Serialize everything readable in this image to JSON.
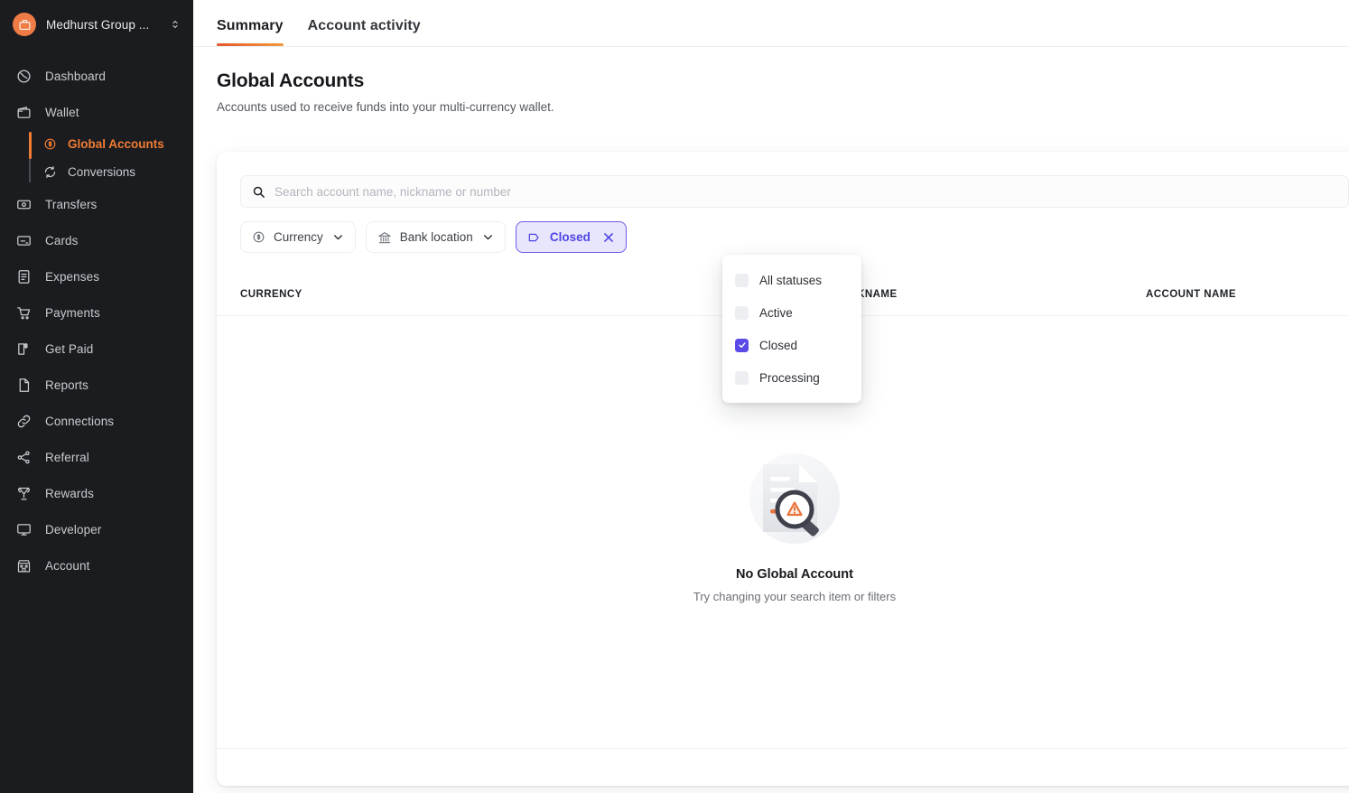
{
  "sidebar": {
    "org": {
      "name": "Medhurst Group ...",
      "logo_icon": "briefcase-icon",
      "switcher_icon": "chevron-up-down-icon",
      "logo_color": "#ef7b45"
    },
    "items": [
      {
        "label": "Dashboard",
        "icon": "dashboard-icon"
      },
      {
        "label": "Wallet",
        "icon": "wallet-icon"
      },
      {
        "label": "Transfers",
        "icon": "transfers-icon"
      },
      {
        "label": "Cards",
        "icon": "cards-icon"
      },
      {
        "label": "Expenses",
        "icon": "expenses-icon"
      },
      {
        "label": "Payments",
        "icon": "payments-cart-icon"
      },
      {
        "label": "Get Paid",
        "icon": "get-paid-icon"
      },
      {
        "label": "Reports",
        "icon": "reports-document-icon"
      },
      {
        "label": "Connections",
        "icon": "connections-link-icon"
      },
      {
        "label": "Referral",
        "icon": "referral-share-icon"
      },
      {
        "label": "Rewards",
        "icon": "rewards-trophy-icon"
      },
      {
        "label": "Developer",
        "icon": "developer-monitor-icon"
      },
      {
        "label": "Account",
        "icon": "account-building-icon"
      }
    ],
    "subitems": [
      {
        "label": "Global Accounts",
        "icon": "coin-dollar-icon",
        "active": true
      },
      {
        "label": "Conversions",
        "icon": "conversions-refresh-icon",
        "active": false
      }
    ],
    "active_color": "#f07c33"
  },
  "tabs": [
    {
      "label": "Summary",
      "active": true
    },
    {
      "label": "Account activity",
      "active": false
    }
  ],
  "page": {
    "title": "Global Accounts",
    "subtitle": "Accounts used to receive funds into your multi-currency wallet."
  },
  "search": {
    "placeholder": "Search account name, nickname or number",
    "value": "",
    "icon": "search-icon"
  },
  "filters": [
    {
      "label": "Currency",
      "icon": "coin-dollar-icon",
      "caret": "chevron-down-icon",
      "selected": false
    },
    {
      "label": "Bank location",
      "icon": "bank-icon",
      "caret": "chevron-down-icon",
      "selected": false
    },
    {
      "label": "Closed",
      "icon": "tag-icon",
      "caret": "close-x-icon",
      "selected": true
    }
  ],
  "status_dropdown": {
    "open": true,
    "accent_color": "#5b4ae8",
    "options": [
      {
        "label": "All statuses",
        "checked": false
      },
      {
        "label": "Active",
        "checked": false
      },
      {
        "label": "Closed",
        "checked": true
      },
      {
        "label": "Processing",
        "checked": false
      }
    ]
  },
  "table": {
    "columns": [
      "CURRENCY",
      "NICKNAME",
      "ACCOUNT NAME"
    ]
  },
  "empty_state": {
    "illustration": "document-magnifier-warning-illustration",
    "title": "No Global Account",
    "subtitle": "Try changing your search item or filters"
  }
}
